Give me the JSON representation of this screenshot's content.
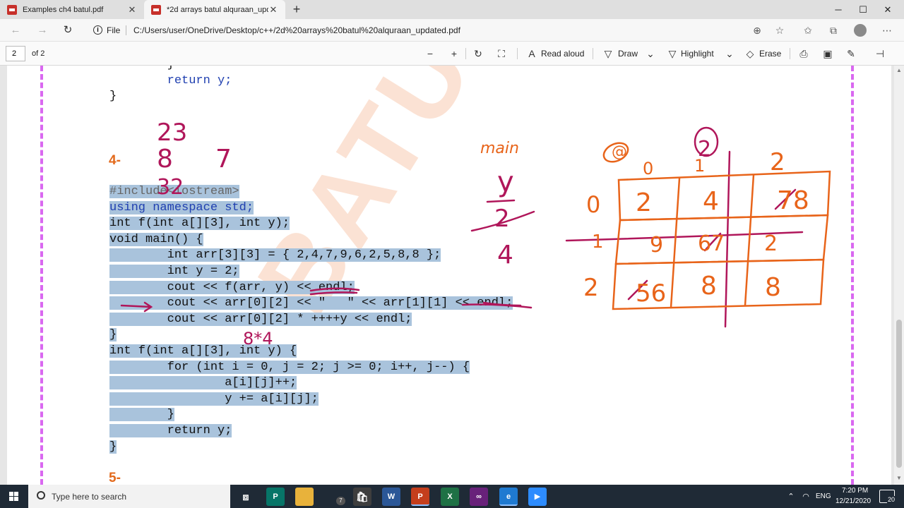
{
  "browser": {
    "tabs": [
      {
        "label": "Examples ch4 batul.pdf",
        "active": false
      },
      {
        "label": "*2d arrays batul alquraan_updat...",
        "active": true
      }
    ],
    "address": {
      "scheme_label": "File",
      "url": "C:/Users/user/OneDrive/Desktop/c++/2d%20arrays%20batul%20alquraan_updated.pdf"
    }
  },
  "pdf_toolbar": {
    "page_number": "2",
    "page_total": "of 2",
    "read_aloud": "Read aloud",
    "draw": "Draw",
    "highlight": "Highlight",
    "erase": "Erase"
  },
  "document": {
    "prev_code_lines": [
      "        }",
      "        return y;",
      "}"
    ],
    "problem_4_label": "4-",
    "problem_5_label": "5-",
    "code_lines": [
      "#include<iostream>",
      "using namespace std;",
      "int f(int a[][3], int y);",
      "void main() {",
      "        int arr[3][3] = { 2,4,7,9,6,2,5,8,8 };",
      "        int y = 2;",
      "        cout << f(arr, y) << endl;",
      "        cout << arr[0][2] << \"   \" << arr[1][1] << endl;",
      "        cout << arr[0][2] * ++++y << endl;",
      "}",
      "int f(int a[][3], int y) {",
      "        for (int i = 0, j = 2; j >= 0; i++, j--) {",
      "                a[i][j]++;",
      "                y += a[i][j];",
      "        }",
      "        return y;",
      "}"
    ],
    "watermark": "BATUL ALQURAAN",
    "handwriting": {
      "stack_values": [
        "23",
        "8",
        "7",
        "32"
      ],
      "main_label": "main",
      "y_label": "y",
      "y_values": [
        "2",
        "4"
      ],
      "product_note": "8*4",
      "matrix_circled": [
        "@",
        "2"
      ],
      "matrix_col_headers": [
        "0",
        "1",
        "2"
      ],
      "matrix_row_headers": [
        "0",
        "1",
        "2"
      ],
      "matrix_cells": [
        [
          "2",
          "4",
          "78"
        ],
        [
          "9",
          "67",
          "2"
        ],
        [
          "56",
          "8",
          "8"
        ]
      ],
      "ink_colors": {
        "magenta": "#b0165a",
        "orange": "#e8641a"
      }
    }
  },
  "taskbar": {
    "search_placeholder": "Type here to search",
    "apps": [
      "task-view",
      "publisher",
      "file-explorer",
      "store",
      "word",
      "powerpoint",
      "excel",
      "visual-studio",
      "edge",
      "zoom"
    ],
    "explorer_badge": "7",
    "language": "ENG",
    "time": "7:20 PM",
    "date": "12/21/2020",
    "notification_count": "20"
  }
}
